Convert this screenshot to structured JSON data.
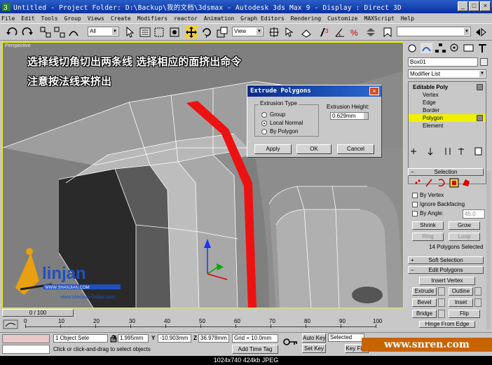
{
  "window": {
    "title": "Untitled    - Project Folder: D:\\Backup\\我的文档\\3dsmax    - Autodesk 3ds Max 9      - Display : Direct 3D",
    "minimize": "_",
    "maximize": "□",
    "close": "×"
  },
  "menu": [
    "File",
    "Edit",
    "Tools",
    "Group",
    "Views",
    "Create",
    "Modifiers",
    "reactor",
    "Animation",
    "Graph Editors",
    "Rendering",
    "Customize",
    "MAXScript",
    "Help"
  ],
  "toolbar": {
    "selection_filter": "All",
    "ref_coord": "View"
  },
  "viewport": {
    "label": "Perspective",
    "caption_line1": "选择线切角切出两条线 选择相应的面挤出命令",
    "caption_line2": "注意按法线来挤出"
  },
  "dialog": {
    "title": "Extrude Polygons",
    "close": "×",
    "group_label": "Extrusion Type",
    "options": [
      "Group",
      "Local Normal",
      "By Polygon"
    ],
    "selected_option": "Local Normal",
    "height_label": "Extrusion Height:",
    "height_value": "0.629mm",
    "apply": "Apply",
    "ok": "OK",
    "cancel": "Cancel"
  },
  "command_panel": {
    "object_name": "Box01",
    "modifier_list": "Modifier List",
    "stack": {
      "root": "Editable Poly",
      "items": [
        "Vertex",
        "Edge",
        "Border",
        "Polygon",
        "Element"
      ],
      "selected": "Polygon"
    },
    "selection": {
      "title": "Selection",
      "by_vertex": "By Vertex",
      "ignore_backfacing": "Ignore Backfacing",
      "by_angle": "By Angle:",
      "angle_value": "45.0",
      "shrink": "Shrink",
      "grow": "Grow",
      "ring": "Ring",
      "loop": "Loop",
      "status": "14 Polygons Selected"
    },
    "soft_selection": "Soft Selection",
    "edit_polygons": {
      "title": "Edit Polygons",
      "insert_vertex": "Insert Vertex",
      "extrude": "Extrude",
      "outline": "Outline",
      "bevel": "Bevel",
      "inset": "Inset",
      "bridge": "Bridge",
      "flip": "Flip",
      "hinge": "Hinge From Edge"
    }
  },
  "timeline": {
    "slider": "0 / 100",
    "ticks": [
      "0",
      "10",
      "20",
      "30",
      "40",
      "50",
      "60",
      "70",
      "80",
      "90",
      "100"
    ]
  },
  "status": {
    "selection": "1 Object Sele",
    "prompt": "Click or click-and-drag to select objects",
    "x_label": "X",
    "x_value": "1.995mm",
    "y_label": "Y",
    "y_value": "-10.903mm",
    "z_label": "Z",
    "z_value": "36.978mm",
    "grid": "Grid = 10.0mm",
    "add_time_tag": "Add Time Tag",
    "auto_key": "Auto Key",
    "set_key": "Set Key",
    "key_mode": "Selected",
    "key_filters": "Key Filte"
  },
  "watermarks": {
    "logo_text": "linjan",
    "logo_sub": "WWW.SHANJIAN.COM",
    "logo_url": "www.shenjian-fudao.com",
    "site": "www.snren.com"
  },
  "footer": "1024x740  424kb  JPEG"
}
